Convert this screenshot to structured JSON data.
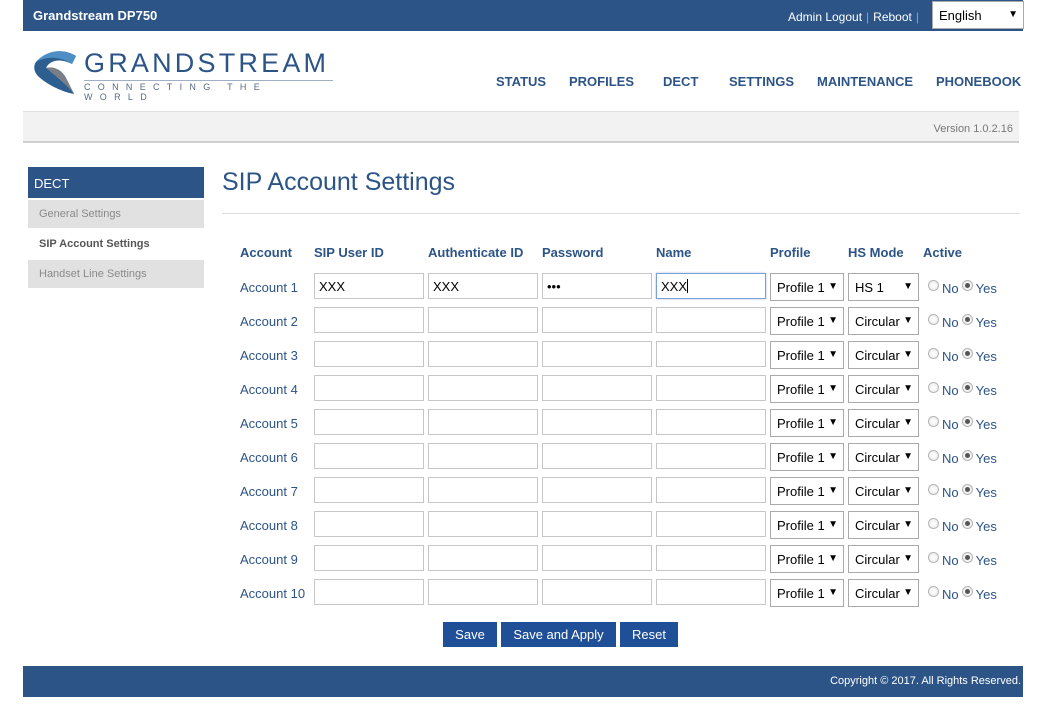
{
  "topbar": {
    "brand": "Grandstream DP750",
    "links": [
      "Admin Logout",
      "Reboot"
    ],
    "language": "English"
  },
  "logo": {
    "wordmark": "GRANDSTREAM",
    "tagline": "CONNECTING THE WORLD",
    "colors": {
      "primary": "#2c5487",
      "swoosh_dark": "#1e4f80",
      "swoosh_light": "#4d8fc4"
    }
  },
  "nav": {
    "items": [
      "STATUS",
      "PROFILES",
      "DECT",
      "SETTINGS",
      "MAINTENANCE",
      "PHONEBOOK"
    ]
  },
  "version": "Version 1.0.2.16",
  "sidebar": {
    "heading": "DECT",
    "items": [
      {
        "label": "General Settings",
        "active": false
      },
      {
        "label": "SIP Account Settings",
        "active": true
      },
      {
        "label": "Handset Line Settings",
        "active": false
      }
    ]
  },
  "page": {
    "title": "SIP Account Settings",
    "columns": [
      "Account",
      "SIP User ID",
      "Authenticate ID",
      "Password",
      "Name",
      "Profile",
      "HS Mode",
      "Active"
    ],
    "radio_labels": {
      "no": "No",
      "yes": "Yes"
    },
    "rows": [
      {
        "account": "Account 1",
        "sip_user_id": "XXX",
        "auth_id": "XXX",
        "password": "•••",
        "name": "XXX",
        "profile": "Profile 1",
        "hs_mode": "HS 1",
        "active": "Yes"
      },
      {
        "account": "Account 2",
        "sip_user_id": "",
        "auth_id": "",
        "password": "",
        "name": "",
        "profile": "Profile 1",
        "hs_mode": "Circular",
        "active": "Yes"
      },
      {
        "account": "Account 3",
        "sip_user_id": "",
        "auth_id": "",
        "password": "",
        "name": "",
        "profile": "Profile 1",
        "hs_mode": "Circular",
        "active": "Yes"
      },
      {
        "account": "Account 4",
        "sip_user_id": "",
        "auth_id": "",
        "password": "",
        "name": "",
        "profile": "Profile 1",
        "hs_mode": "Circular",
        "active": "Yes"
      },
      {
        "account": "Account 5",
        "sip_user_id": "",
        "auth_id": "",
        "password": "",
        "name": "",
        "profile": "Profile 1",
        "hs_mode": "Circular",
        "active": "Yes"
      },
      {
        "account": "Account 6",
        "sip_user_id": "",
        "auth_id": "",
        "password": "",
        "name": "",
        "profile": "Profile 1",
        "hs_mode": "Circular",
        "active": "Yes"
      },
      {
        "account": "Account 7",
        "sip_user_id": "",
        "auth_id": "",
        "password": "",
        "name": "",
        "profile": "Profile 1",
        "hs_mode": "Circular",
        "active": "Yes"
      },
      {
        "account": "Account 8",
        "sip_user_id": "",
        "auth_id": "",
        "password": "",
        "name": "",
        "profile": "Profile 1",
        "hs_mode": "Circular",
        "active": "Yes"
      },
      {
        "account": "Account 9",
        "sip_user_id": "",
        "auth_id": "",
        "password": "",
        "name": "",
        "profile": "Profile 1",
        "hs_mode": "Circular",
        "active": "Yes"
      },
      {
        "account": "Account 10",
        "sip_user_id": "",
        "auth_id": "",
        "password": "",
        "name": "",
        "profile": "Profile 1",
        "hs_mode": "Circular",
        "active": "Yes"
      }
    ],
    "focused_field": "name",
    "buttons": {
      "save": "Save",
      "save_apply": "Save and Apply",
      "reset": "Reset"
    }
  },
  "footer": {
    "copyright": "Copyright © 2017. All Rights Reserved."
  }
}
